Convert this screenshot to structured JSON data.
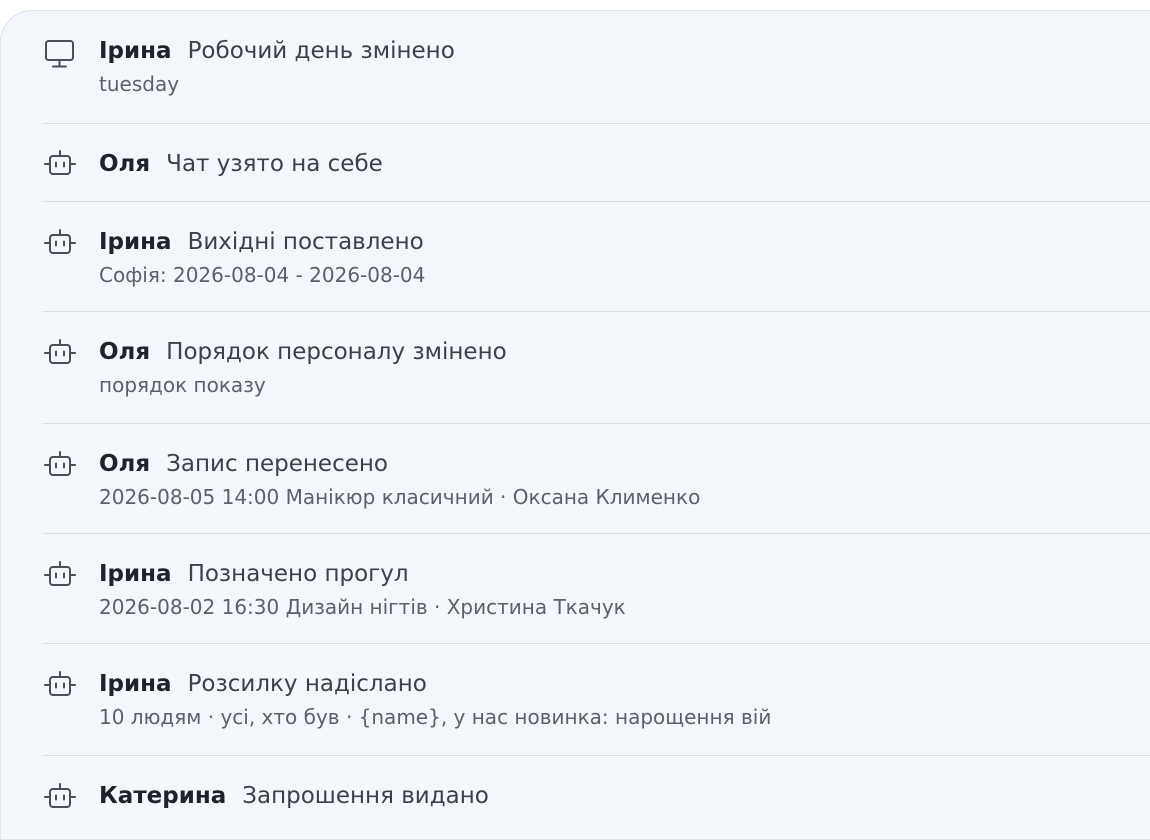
{
  "activity": [
    {
      "icon": "monitor-icon",
      "author": "Ірина",
      "action": "Робочий день змінено",
      "detail": "tuesday"
    },
    {
      "icon": "robot-icon",
      "author": "Оля",
      "action": "Чат узято на себе",
      "detail": ""
    },
    {
      "icon": "robot-icon",
      "author": "Ірина",
      "action": "Вихідні поставлено",
      "detail": "Софія: 2026-08-04 - 2026-08-04"
    },
    {
      "icon": "robot-icon",
      "author": "Оля",
      "action": "Порядок персоналу змінено",
      "detail": "порядок показу"
    },
    {
      "icon": "robot-icon",
      "author": "Оля",
      "action": "Запис перенесено",
      "detail": "2026-08-05 14:00 Манікюр класичний · Оксана Клименко"
    },
    {
      "icon": "robot-icon",
      "author": "Ірина",
      "action": "Позначено прогул",
      "detail": "2026-08-02 16:30 Дизайн нігтів · Христина Ткачук"
    },
    {
      "icon": "robot-icon",
      "author": "Ірина",
      "action": "Розсилку надіслано",
      "detail": "10 людям · усі, хто був · {name}, у нас новинка: нарощення вій"
    },
    {
      "icon": "robot-icon",
      "author": "Катерина",
      "action": "Запрошення видано",
      "detail": ""
    }
  ]
}
